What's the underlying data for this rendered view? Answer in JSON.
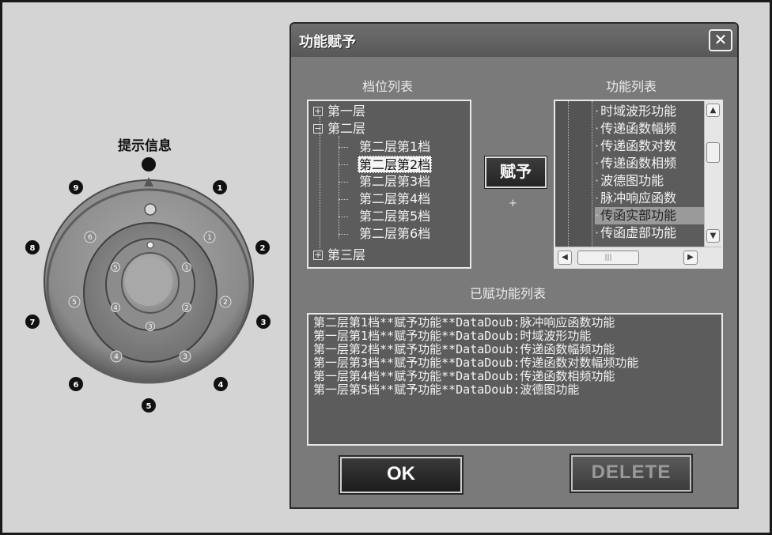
{
  "knob": {
    "title": "提示信息",
    "outer_marks": [
      "1",
      "2",
      "3",
      "4",
      "5",
      "6",
      "7",
      "8",
      "9"
    ],
    "inner_marks": [
      "1",
      "2",
      "3",
      "4",
      "5",
      "6"
    ],
    "core_marks": [
      "1",
      "2",
      "3",
      "4",
      "5",
      "6"
    ]
  },
  "dialog": {
    "title": "功能赋予",
    "close_symbol": "✕",
    "gear_list_label": "档位列表",
    "function_list_label": "功能列表",
    "assigned_label": "已赋功能列表",
    "assign_button": "赋予",
    "plus": "+",
    "ok_button": "OK",
    "delete_button": "DELETE",
    "gear_tree": {
      "level1": "第一层",
      "level2": "第二层",
      "level2_children": [
        "第二层第1档",
        "第二层第2档",
        "第二层第3档",
        "第二层第4档",
        "第二层第5档",
        "第二层第6档"
      ],
      "level3": "第三层",
      "selected": "第二层第2档"
    },
    "functions": [
      "时域波形功能",
      "传递函数幅频",
      "传递函数对数",
      "传递函数相频",
      "波德图功能",
      "脉冲响应函数",
      "传函实部功能",
      "传函虚部功能"
    ],
    "highlighted_function": "传函实部功能",
    "assigned": [
      "第二层第1档**赋予功能**DataDoub:脉冲响应函数功能",
      "第一层第1档**赋予功能**DataDoub:时域波形功能",
      "第一层第2档**赋予功能**DataDoub:传递函数幅频功能",
      "第一层第3档**赋予功能**DataDoub:传递函数对数幅频功能",
      "第一层第4档**赋予功能**DataDoub:传递函数相频功能",
      "第一层第5档**赋予功能**DataDoub:波德图功能"
    ],
    "scroll_grip": "|||"
  }
}
